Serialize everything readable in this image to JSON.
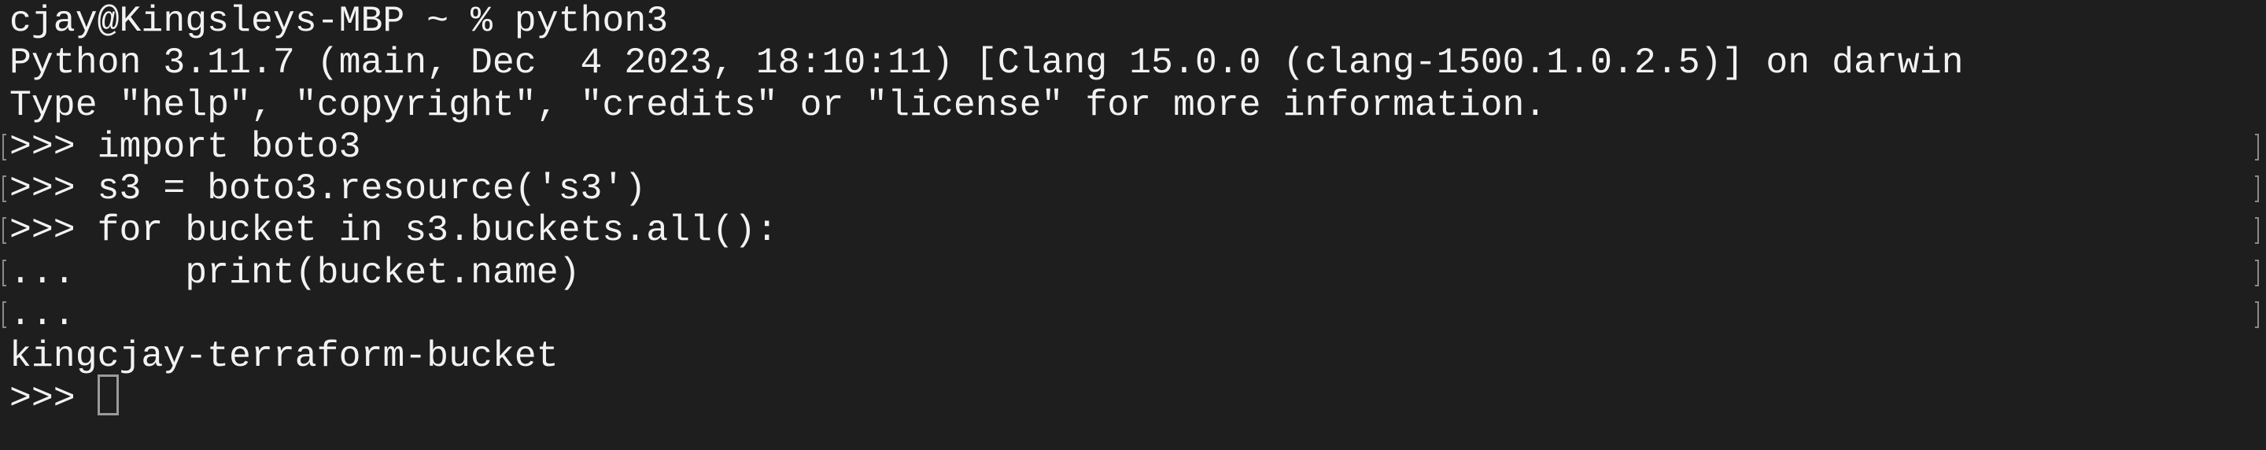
{
  "terminal": {
    "lines": [
      {
        "text": "cjay@Kingsleys-MBP ~ % python3",
        "marked": false
      },
      {
        "text": "Python 3.11.7 (main, Dec  4 2023, 18:10:11) [Clang 15.0.0 (clang-1500.1.0.2.5)] on darwin",
        "marked": false
      },
      {
        "text": "Type \"help\", \"copyright\", \"credits\" or \"license\" for more information.",
        "marked": false
      },
      {
        "text": ">>> import boto3",
        "marked": true
      },
      {
        "text": ">>> s3 = boto3.resource('s3')",
        "marked": true
      },
      {
        "text": ">>> for bucket in s3.buckets.all():",
        "marked": true
      },
      {
        "text": "...     print(bucket.name)",
        "marked": true
      },
      {
        "text": "...",
        "marked": true
      },
      {
        "text": "kingcjay-terraform-bucket",
        "marked": false
      }
    ],
    "prompt": ">>> "
  }
}
